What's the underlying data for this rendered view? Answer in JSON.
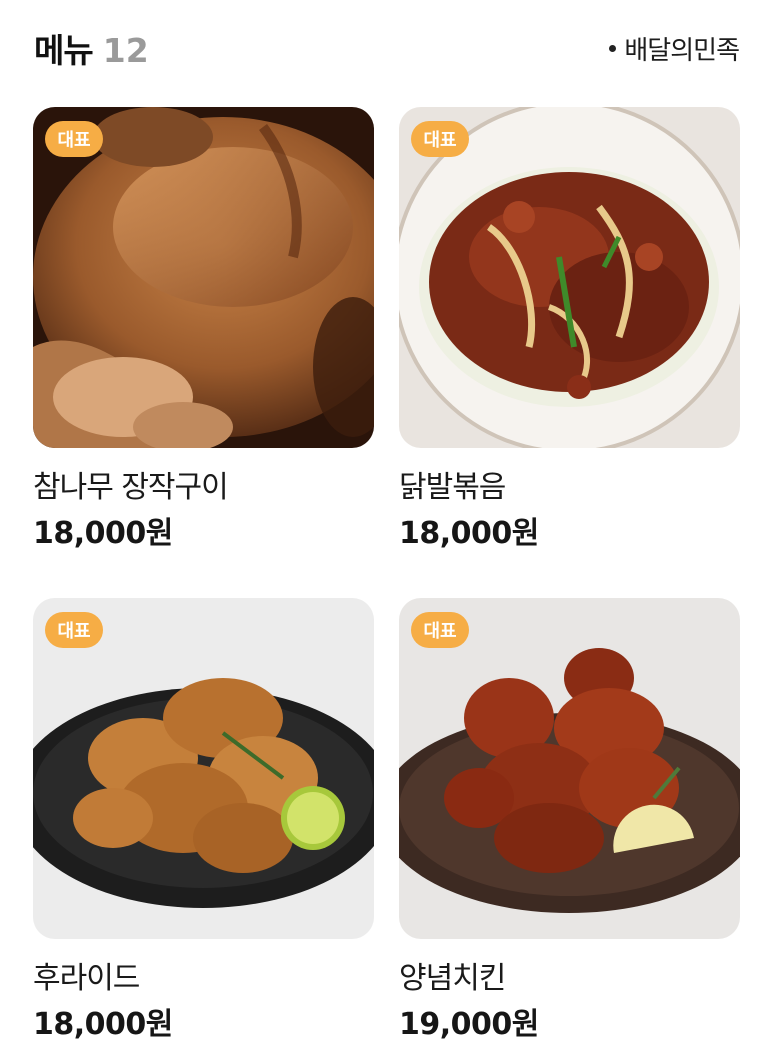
{
  "header": {
    "title": "메뉴",
    "count": "12",
    "source": "배달의민족",
    "source_icon": "dot-icon"
  },
  "menu": [
    {
      "badge": "대표",
      "name": "참나무 장작구이",
      "price": "18,000원",
      "image": "roast-chicken-photo"
    },
    {
      "badge": "대표",
      "name": "닭발볶음",
      "price": "18,000원",
      "image": "spicy-chicken-feet-photo"
    },
    {
      "badge": "대표",
      "name": "후라이드",
      "price": "18,000원",
      "image": "fried-chicken-photo"
    },
    {
      "badge": "대표",
      "name": "양념치킨",
      "price": "19,000원",
      "image": "seasoned-chicken-photo"
    }
  ],
  "colors": {
    "badge": "#f6ad45",
    "count": "#9a9a9a",
    "text": "#111111"
  }
}
